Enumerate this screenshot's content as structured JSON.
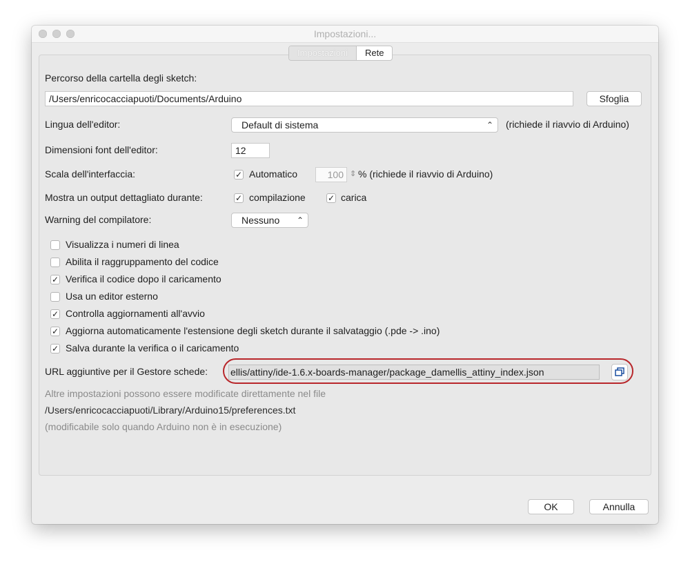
{
  "window": {
    "title": "Impostazioni..."
  },
  "tabs": [
    {
      "label": "Impostazioni"
    },
    {
      "label": "Rete"
    }
  ],
  "sketchbook": {
    "label": "Percorso della cartella degli sketch:",
    "value": "/Users/enricocacciapuoti/Documents/Arduino",
    "browse_label": "Sfoglia"
  },
  "language": {
    "label": "Lingua dell'editor:",
    "value": "Default di sistema",
    "note": "(richiede il riavvio di Arduino)"
  },
  "font_size": {
    "label": "Dimensioni font dell'editor:",
    "value": "12"
  },
  "scale": {
    "label": "Scala dell'interfaccia:",
    "auto_label": "Automatico",
    "auto_checked": true,
    "value": "100",
    "note": "% (richiede il riavvio di Arduino)"
  },
  "verbose": {
    "label": "Mostra un output dettagliato durante:",
    "compile_label": "compilazione",
    "compile_checked": true,
    "upload_label": "carica",
    "upload_checked": true
  },
  "warnings": {
    "label": "Warning del compilatore:",
    "value": "Nessuno"
  },
  "options": [
    {
      "label": "Visualizza i numeri di linea",
      "checked": false
    },
    {
      "label": "Abilita il raggruppamento del codice",
      "checked": false
    },
    {
      "label": "Verifica il codice dopo il caricamento",
      "checked": true
    },
    {
      "label": "Usa un editor esterno",
      "checked": false
    },
    {
      "label": "Controlla aggiornamenti all'avvio",
      "checked": true
    },
    {
      "label": "Aggiorna automaticamente l'estensione degli sketch durante il salvataggio (.pde -> .ino)",
      "checked": true
    },
    {
      "label": "Salva durante la verifica o il caricamento",
      "checked": true
    }
  ],
  "boards_url": {
    "label": "URL aggiuntive per il Gestore schede:",
    "value": "ellis/attiny/ide-1.6.x-boards-manager/package_damellis_attiny_index.json"
  },
  "footer": {
    "line1": "Altre impostazioni possono essere modificate direttamente nel file",
    "line2": "/Users/enricocacciapuoti/Library/Arduino15/preferences.txt",
    "line3": "(modificabile solo quando Arduino non è in esecuzione)"
  },
  "buttons": {
    "ok": "OK",
    "cancel": "Annulla"
  },
  "check_glyph": "✓",
  "colors": {
    "highlight": "#b8262a"
  }
}
